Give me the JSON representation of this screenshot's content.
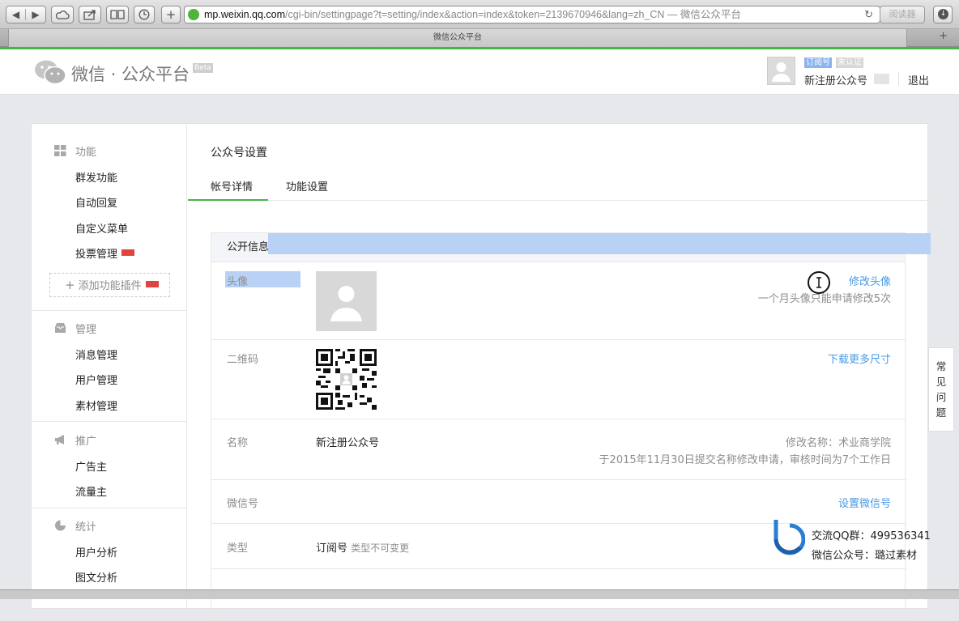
{
  "browser": {
    "url_domain": "mp.weixin.qq.com",
    "url_rest": "/cgi-bin/settingpage?t=setting/index&action=index&token=2139670946&lang=zh_CN — 微信公众平台",
    "reader_label": "阅读器",
    "tab_title": "微信公众平台",
    "reload_glyph": "↻",
    "newtab_glyph": "+"
  },
  "header": {
    "brand": "微信 · 公众平台",
    "beta": "Beta",
    "badge_subscribe": "订阅号",
    "badge_unverified": "未认证",
    "account_name": "新注册公众号",
    "logout": "退出"
  },
  "sidebar": {
    "group_function": "功能",
    "function_items": [
      "群发功能",
      "自动回复",
      "自定义菜单",
      "投票管理"
    ],
    "add_plugin": "添加功能插件",
    "group_manage": "管理",
    "manage_items": [
      "消息管理",
      "用户管理",
      "素材管理"
    ],
    "group_promote": "推广",
    "promote_items": [
      "广告主",
      "流量主"
    ],
    "group_stats": "统计",
    "stats_items": [
      "用户分析",
      "图文分析"
    ]
  },
  "content": {
    "page_title": "公众号设置",
    "tabs": [
      "帐号详情",
      "功能设置"
    ],
    "section_title": "公开信息",
    "rows": {
      "avatar_label": "头像",
      "avatar_action": "修改头像",
      "avatar_note": "一个月头像只能申请修改5次",
      "qrcode_label": "二维码",
      "qrcode_action": "下载更多尺寸",
      "name_label": "名称",
      "name_value": "新注册公众号",
      "name_note1": "修改名称：术业商学院",
      "name_note2": "于2015年11月30日提交名称修改申请，审核时间为7个工作日",
      "wechat_id_label": "微信号",
      "wechat_id_action": "设置微信号",
      "type_label": "类型",
      "type_value": "订阅号",
      "type_note": "类型不可变更"
    }
  },
  "faq": [
    "常",
    "见",
    "问",
    "题"
  ],
  "watermark": {
    "line1": "交流QQ群：499536341",
    "line2": "微信公众号：璐过素材"
  },
  "colors": {
    "accent_green": "#44b549",
    "link_blue": "#459ae9",
    "selection_blue": "#b8d1f4",
    "new_badge_red": "#e0443e"
  }
}
